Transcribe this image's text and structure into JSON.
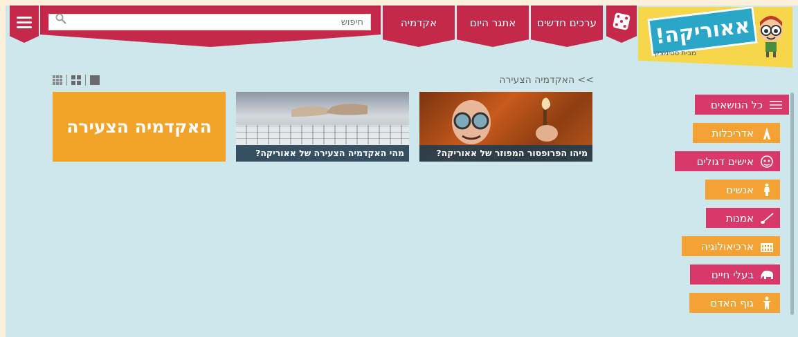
{
  "header": {
    "search_placeholder": "חיפוש",
    "nav": [
      {
        "label": "אקדמיה"
      },
      {
        "label": "אתגר היום"
      },
      {
        "label": "ערכים חדשים"
      }
    ]
  },
  "logo": {
    "title": "אאוריקה!",
    "subtitle": "מבית סטימצקי"
  },
  "breadcrumb": ">> האקדמיה הצעירה",
  "cards": [
    {
      "caption": "מיהו הפרופסור המפוזר של אאוריקה?"
    },
    {
      "caption": "מהי האקדמיה הצעירה של אאוריקה?"
    },
    {
      "title": "האקדמיה הצעירה"
    }
  ],
  "sidebar": {
    "items": [
      {
        "label": "כל הנושאים",
        "color": "#d9386a",
        "icon": "list-icon"
      },
      {
        "label": "אדריכלות",
        "color": "#f3a233",
        "icon": "eiffel-tower-icon"
      },
      {
        "label": "אישים דגולים",
        "color": "#d9386a",
        "icon": "einstein-face-icon"
      },
      {
        "label": "אנשים",
        "color": "#f3a233",
        "icon": "person-icon"
      },
      {
        "label": "אמנות",
        "color": "#d9386a",
        "icon": "paintbrush-icon"
      },
      {
        "label": "ארכיאולוגיה",
        "color": "#f3a233",
        "icon": "colosseum-icon"
      },
      {
        "label": "בעלי חיים",
        "color": "#d9386a",
        "icon": "elephant-icon"
      },
      {
        "label": "גוף האדם",
        "color": "#f3a233",
        "icon": "human-body-icon"
      }
    ]
  },
  "colors": {
    "accent_red": "#c4284b",
    "pink": "#d9386a",
    "orange": "#f3a233",
    "background": "#cde7ea"
  }
}
